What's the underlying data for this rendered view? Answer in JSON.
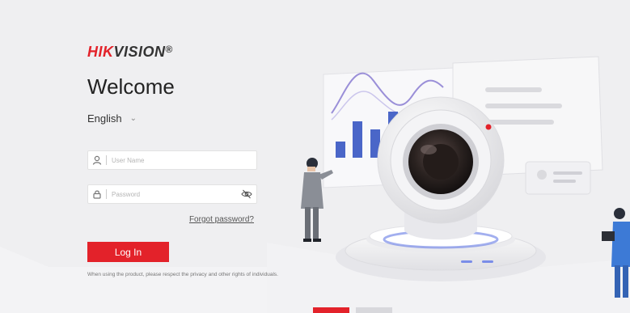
{
  "brand": {
    "logo_main": "HIK",
    "logo_rest": "VISION",
    "logo_mark": "®",
    "accent": "#e3222a"
  },
  "welcome": "Welcome",
  "language": {
    "selected": "English"
  },
  "username": {
    "placeholder": "User Name",
    "icon": "user-icon"
  },
  "password": {
    "placeholder": "Password",
    "icon": "lock-icon",
    "toggle_icon": "eye-off-icon"
  },
  "forgot_label": "Forgot password?",
  "login_label": "Log In",
  "notice": "When using the product, please respect the privacy and other rights of individuals."
}
